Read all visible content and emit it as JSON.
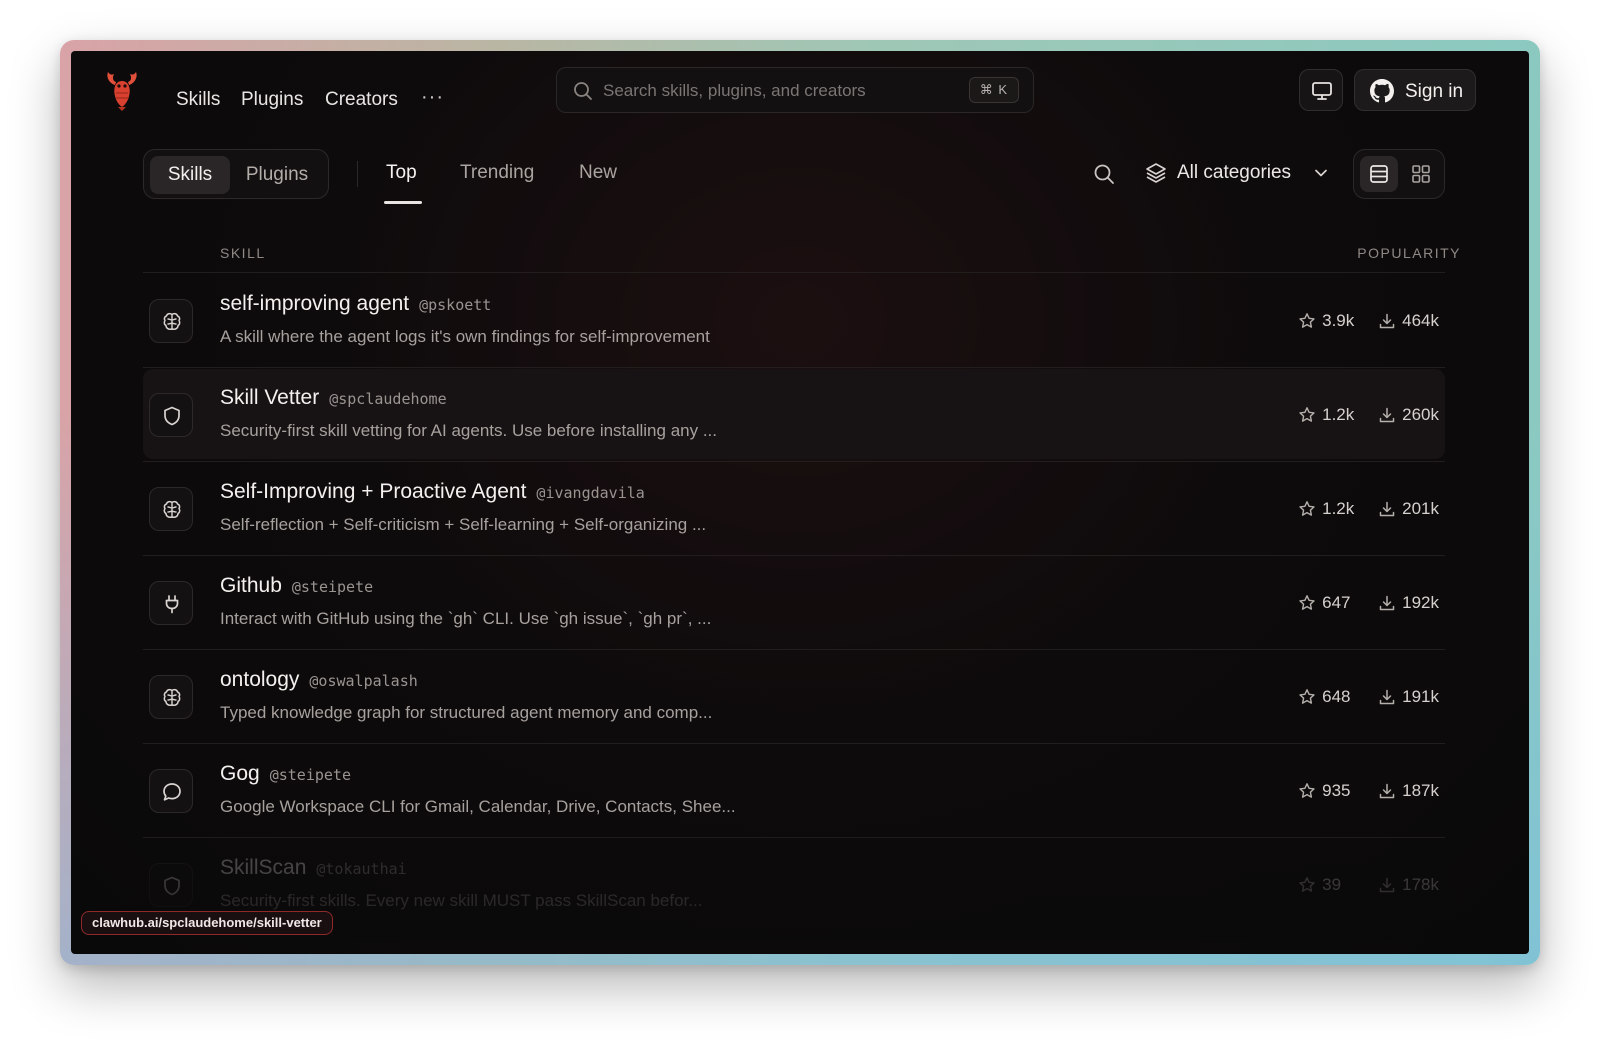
{
  "nav": {
    "links": [
      "Skills",
      "Plugins",
      "Creators"
    ],
    "more": "···",
    "search_placeholder": "Search skills, plugins, and creators",
    "search_shortcut": "⌘ K",
    "sign_in": "Sign in"
  },
  "toolbar": {
    "segment": [
      "Skills",
      "Plugins"
    ],
    "tabs": [
      "Top",
      "Trending",
      "New"
    ],
    "category": "All categories"
  },
  "table": {
    "col_skill": "SKILL",
    "col_popularity": "POPULARITY",
    "rows": [
      {
        "title": "self-improving agent",
        "handle": "@pskoett",
        "desc": "A skill where the agent logs it's own findings for self-improvement",
        "stars": "3.9k",
        "downloads": "464k",
        "icon": "brain-icon"
      },
      {
        "title": "Skill Vetter",
        "handle": "@spclaudehome",
        "desc": "Security-first skill vetting for AI agents. Use before installing any ...",
        "stars": "1.2k",
        "downloads": "260k",
        "icon": "shield-icon"
      },
      {
        "title": "Self-Improving + Proactive Agent",
        "handle": "@ivangdavila",
        "desc": "Self-reflection + Self-criticism + Self-learning + Self-organizing ...",
        "stars": "1.2k",
        "downloads": "201k",
        "icon": "brain-icon"
      },
      {
        "title": "Github",
        "handle": "@steipete",
        "desc": "Interact with GitHub using the `gh` CLI. Use `gh issue`, `gh pr`, ...",
        "stars": "647",
        "downloads": "192k",
        "icon": "plug-icon"
      },
      {
        "title": "ontology",
        "handle": "@oswalpalash",
        "desc": "Typed knowledge graph for structured agent memory and comp...",
        "stars": "648",
        "downloads": "191k",
        "icon": "brain-icon"
      },
      {
        "title": "Gog",
        "handle": "@steipete",
        "desc": "Google Workspace CLI for Gmail, Calendar, Drive, Contacts, Shee...",
        "stars": "935",
        "downloads": "187k",
        "icon": "chat-icon"
      },
      {
        "title": "SkillScan",
        "handle": "@tokauthai",
        "desc": "Security-first skills. Every new skill MUST pass SkillScan befor...",
        "stars": "39",
        "downloads": "178k",
        "icon": "shield-icon"
      }
    ]
  },
  "status_url": "clawhub.ai/spclaudehome/skill-vetter",
  "colors": {
    "accent": "#e0483a",
    "background": "#0e0b0c",
    "status_border": "#8e2a2a"
  }
}
